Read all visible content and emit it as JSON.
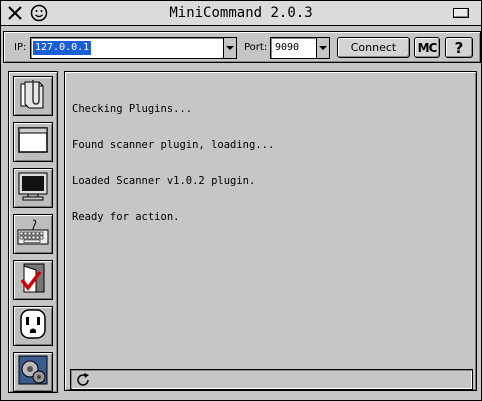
{
  "window": {
    "title": "MiniCommand 2.0.3",
    "close_icon": "close-x-icon",
    "smiley_icon": "smiley-icon",
    "minimize_icon": "minimize-icon"
  },
  "toolbar": {
    "ip_label": "IP:",
    "ip_value": "127.0.0.1",
    "port_label": "Port:",
    "port_value": "9090",
    "connect_label": "Connect",
    "mc_label": "MC",
    "help_label": "?"
  },
  "sidebar": {
    "items": [
      {
        "name": "clipboard-icon"
      },
      {
        "name": "window-icon"
      },
      {
        "name": "monitor-icon"
      },
      {
        "name": "keyboard-icon"
      },
      {
        "name": "red-check-icon"
      },
      {
        "name": "power-outlet-icon"
      },
      {
        "name": "gears-icon"
      }
    ]
  },
  "console": {
    "lines": [
      "Checking Plugins...",
      "Found scanner plugin, loading...",
      "Loaded Scanner v1.0.2 plugin.",
      "Ready for action."
    ]
  },
  "colors": {
    "selection": "#1a5fd6",
    "background": "#c6c6c6"
  }
}
